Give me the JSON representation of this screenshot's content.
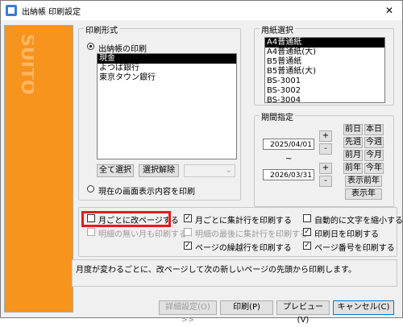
{
  "window": {
    "title": "出納帳 印刷設定",
    "close": "✕"
  },
  "brand": {
    "logo_text": "SUITO",
    "color": "#f7941d"
  },
  "print_format": {
    "legend": "印刷形式",
    "radio_ledger": "出納帳の印刷",
    "accounts": [
      "現金",
      "よつば銀行",
      "東京タウン銀行"
    ],
    "selected_account": "現金",
    "select_all": "全て選択",
    "deselect": "選択解除",
    "dropdown_value": "",
    "radio_screen": "現在の画面表示内容を印刷"
  },
  "paper": {
    "legend": "用紙選択",
    "items": [
      "A4普通紙",
      "A4普通紙(大)",
      "B5普通紙",
      "B5普通紙(大)",
      "BS-3001",
      "BS-3002",
      "BS-3004"
    ],
    "selected": "A4普通紙"
  },
  "period": {
    "legend": "期間指定",
    "start_date": "2025/04/01",
    "end_date": "2026/03/31",
    "tilde": "~",
    "plus": "+",
    "minus": "-",
    "buttons": [
      "前日",
      "本日",
      "先週",
      "今週",
      "前月",
      "今月",
      "前年",
      "今年"
    ],
    "show_prev_year": "表示前年",
    "show_year": "表示年"
  },
  "options": {
    "monthly_page_break": {
      "label": "月ごとに改ページする",
      "checked": false
    },
    "print_monthly_totals": {
      "label": "月ごとに集計行を印刷する",
      "checked": true
    },
    "auto_shrink_text": {
      "label": "自動的に文字を縮小する",
      "checked": false
    },
    "print_empty_months": {
      "label": "明細の無い月も印刷する",
      "checked": false
    },
    "print_final_totals": {
      "label": "明細の最後に集計行を印刷する",
      "checked": false
    },
    "print_print_date": {
      "label": "印刷日を印刷する",
      "checked": true
    },
    "print_carryover": {
      "label": "ページの繰越行を印刷する",
      "checked": true
    },
    "print_page_numbers": {
      "label": "ページ番号を印刷する",
      "checked": true
    }
  },
  "message": "月度が変わるごとに、改ページして次の新しいページの先頭から印刷します。",
  "footer": {
    "advanced": "詳細設定(O) >>",
    "print": "印刷(P)",
    "preview": "プレビュー(V)",
    "cancel": "キャンセル(C)"
  }
}
